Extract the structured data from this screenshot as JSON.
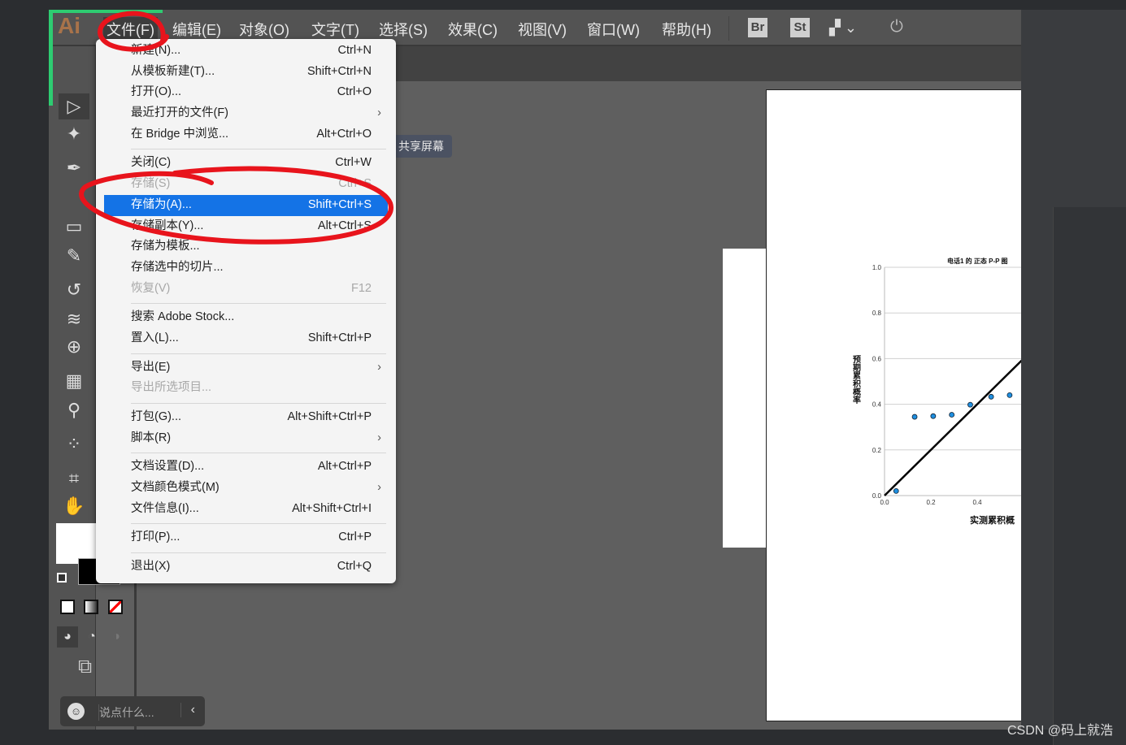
{
  "app": {
    "logo": "Ai"
  },
  "menubar": {
    "items": [
      "文件(F)",
      "编辑(E)",
      "对象(O)",
      "文字(T)",
      "选择(S)",
      "效果(C)",
      "视图(V)",
      "窗口(W)",
      "帮助(H)"
    ],
    "bridge": "Br",
    "stock": "St"
  },
  "collapse": "‹‹",
  "share_label": "共享屏幕",
  "file_menu": [
    {
      "label": "新建(N)...",
      "shortcut": "Ctrl+N"
    },
    {
      "label": "从模板新建(T)...",
      "shortcut": "Shift+Ctrl+N"
    },
    {
      "label": "打开(O)...",
      "shortcut": "Ctrl+O"
    },
    {
      "label": "最近打开的文件(F)",
      "submenu": true
    },
    {
      "label": "在 Bridge 中浏览...",
      "shortcut": "Alt+Ctrl+O"
    },
    {
      "sep": true
    },
    {
      "label": "关闭(C)",
      "shortcut": "Ctrl+W"
    },
    {
      "label": "存储(S)",
      "shortcut": "Ctrl+S",
      "disabled": true
    },
    {
      "label": "存储为(A)...",
      "shortcut": "Shift+Ctrl+S",
      "selected": true
    },
    {
      "label": "存储副本(Y)...",
      "shortcut": "Alt+Ctrl+S"
    },
    {
      "label": "存储为模板..."
    },
    {
      "label": "存储选中的切片..."
    },
    {
      "label": "恢复(V)",
      "shortcut": "F12",
      "disabled": true
    },
    {
      "sep": true
    },
    {
      "label": "搜索 Adobe Stock..."
    },
    {
      "label": "置入(L)...",
      "shortcut": "Shift+Ctrl+P"
    },
    {
      "sep": true
    },
    {
      "label": "导出(E)",
      "submenu": true
    },
    {
      "label": "导出所选项目...",
      "disabled": true
    },
    {
      "sep": true
    },
    {
      "label": "打包(G)...",
      "shortcut": "Alt+Shift+Ctrl+P"
    },
    {
      "label": "脚本(R)",
      "submenu": true
    },
    {
      "sep": true
    },
    {
      "label": "文档设置(D)...",
      "shortcut": "Alt+Ctrl+P"
    },
    {
      "label": "文档颜色模式(M)",
      "submenu": true
    },
    {
      "label": "文件信息(I)...",
      "shortcut": "Alt+Shift+Ctrl+I"
    },
    {
      "sep": true
    },
    {
      "label": "打印(P)...",
      "shortcut": "Ctrl+P"
    },
    {
      "sep": true
    },
    {
      "label": "退出(X)",
      "shortcut": "Ctrl+Q"
    }
  ],
  "chat": {
    "placeholder": "说点什么..."
  },
  "watermark": "CSDN @码上就浩",
  "colors": {
    "accent": "#1473e6",
    "annotation": "#e8141c",
    "green": "#2ecc71"
  },
  "chart_data": {
    "type": "scatter",
    "title": "电话1 的 正态 P-P 图",
    "xlabel": "实测累积概",
    "ylabel": "预期累积概率",
    "xlim": [
      0,
      1
    ],
    "ylim": [
      0,
      1
    ],
    "yticks": [
      "0.0",
      "0.2",
      "0.4",
      "0.6",
      "0.8",
      "1.0"
    ],
    "xticks": [
      "0.0",
      "0.2",
      "0.4"
    ],
    "points": [
      [
        0.05,
        0.02
      ],
      [
        0.13,
        0.345
      ],
      [
        0.21,
        0.348
      ],
      [
        0.29,
        0.354
      ],
      [
        0.37,
        0.398
      ],
      [
        0.46,
        0.433
      ],
      [
        0.54,
        0.44
      ]
    ],
    "reference_line": "y=x",
    "grid": true,
    "point_color": "#1f8fe0"
  }
}
